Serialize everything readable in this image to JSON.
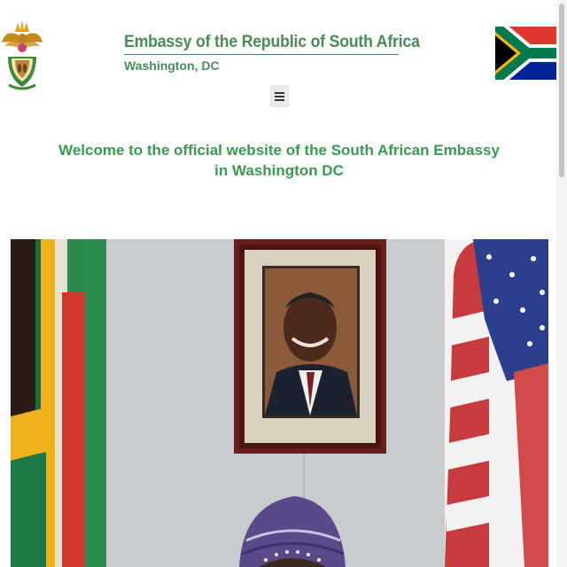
{
  "header": {
    "title": "Embassy of the Republic of South Africa",
    "subtitle": "Washington, DC",
    "logo_icon": "coat-of-arms-icon",
    "flag_icon": "south-africa-flag-icon",
    "menu_icon": "hamburger-menu-icon"
  },
  "welcome": {
    "line1": "Welcome to the official website of the South African Embassy",
    "line2": "in Washington DC"
  },
  "colors": {
    "brand_green": "#4a8a5a",
    "welcome_green": "#3a9a52",
    "menu_bg": "#e9e9e9"
  }
}
